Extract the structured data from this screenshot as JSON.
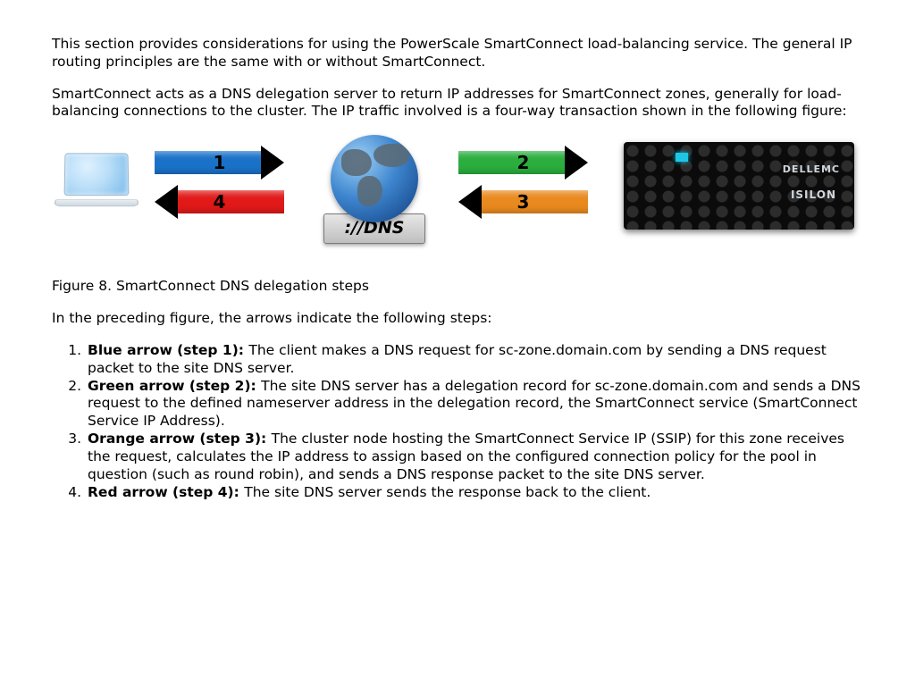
{
  "para1": "This section provides considerations for using the PowerScale SmartConnect load-balancing service. The general IP routing principles are the same with or without SmartConnect.",
  "para2": "SmartConnect acts as a DNS delegation server to return IP addresses for SmartConnect zones, generally for load-balancing connections to the cluster. The IP traffic involved is a four-way transaction shown in the following figure:",
  "figureCaption": "Figure 8. SmartConnect DNS delegation steps",
  "para3": "In the preceding figure, the arrows indicate the following steps:",
  "diagram": {
    "arrow1": "1",
    "arrow2": "2",
    "arrow3": "3",
    "arrow4": "4",
    "dnsLabel": "://DNS",
    "appliance": {
      "brand1": "DELLEMC",
      "brand2": "ISILON"
    }
  },
  "steps": [
    {
      "lead": "Blue arrow (step 1): ",
      "text": "The client makes a DNS request for sc-zone.domain.com by sending a DNS request packet to the site DNS server."
    },
    {
      "lead": "Green arrow (step 2): ",
      "text": "The site DNS server has a delegation record for sc-zone.domain.com and sends a DNS request to the defined nameserver address in the delegation record, the SmartConnect service (SmartConnect Service IP Address)."
    },
    {
      "lead": "Orange arrow (step 3): ",
      "text": "The cluster node hosting the SmartConnect Service IP (SSIP) for this zone receives the request, calculates the IP address to assign based on the configured connection policy for the pool in question (such as round robin), and sends a DNS response packet to the site DNS server."
    },
    {
      "lead": "Red arrow (step 4): ",
      "text": "The site DNS server sends the response back to the client."
    }
  ]
}
